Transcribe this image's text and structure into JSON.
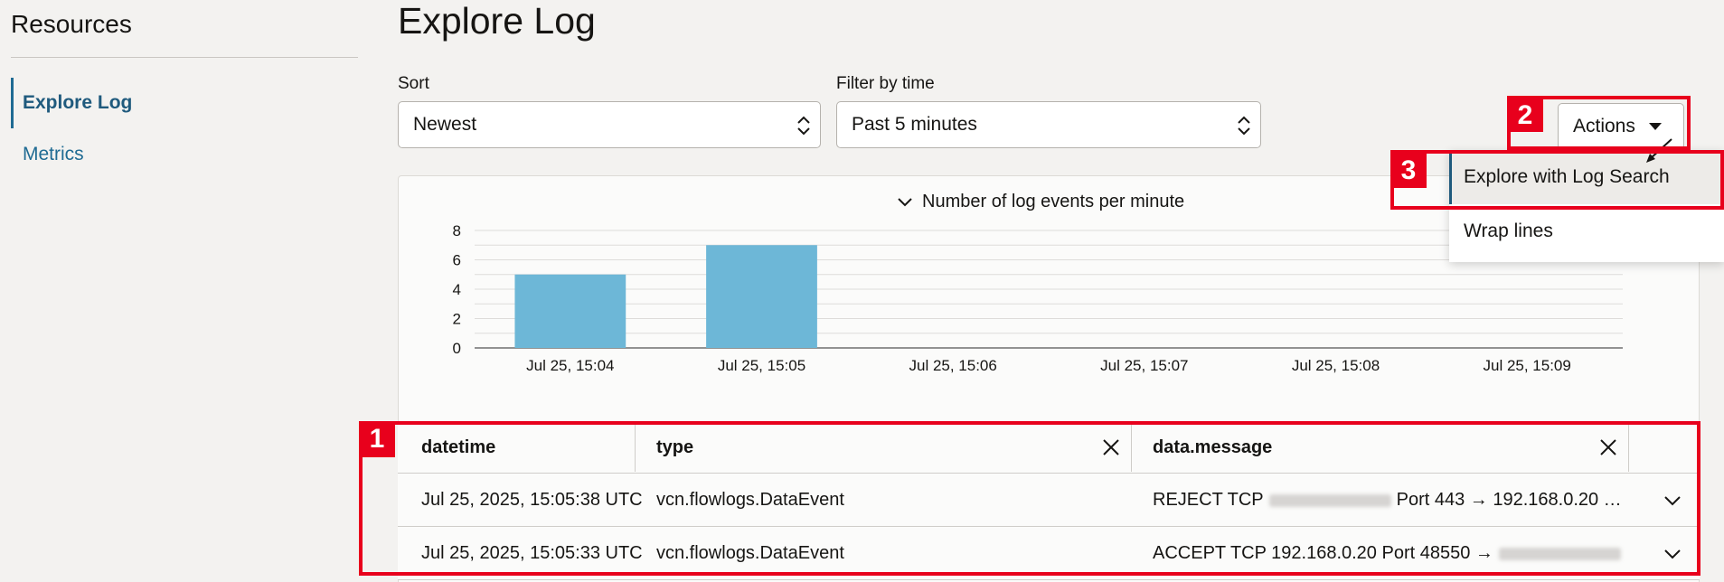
{
  "sidebar": {
    "title": "Resources",
    "items": [
      {
        "label": "Explore Log",
        "active": true
      },
      {
        "label": "Metrics",
        "active": false
      }
    ]
  },
  "page": {
    "title": "Explore Log"
  },
  "sort": {
    "label": "Sort",
    "value": "Newest"
  },
  "filter": {
    "label": "Filter by time",
    "value": "Past 5 minutes"
  },
  "actions": {
    "label": "Actions",
    "menu": [
      "Explore with Log Search",
      "Wrap lines"
    ]
  },
  "chart_data": {
    "type": "bar",
    "title": "Number of log events per minute",
    "categories": [
      "Jul 25, 15:04",
      "Jul 25, 15:05",
      "Jul 25, 15:06",
      "Jul 25, 15:07",
      "Jul 25, 15:08",
      "Jul 25, 15:09"
    ],
    "values": [
      5,
      7,
      0,
      0,
      0,
      0
    ],
    "ylim": [
      0,
      8
    ],
    "yticks": [
      0,
      2,
      4,
      6,
      8
    ],
    "grid": true,
    "color": "#6db7d7"
  },
  "table": {
    "columns": [
      "datetime",
      "type",
      "data.message"
    ],
    "rows": [
      {
        "datetime": "Jul 25, 2025, 15:05:38 UTC",
        "type": "vcn.flowlogs.DataEvent",
        "msg_pre": "REJECT TCP",
        "msg_post": "Port 443 → 192.168.0.20 …"
      },
      {
        "datetime": "Jul 25, 2025, 15:05:33 UTC",
        "type": "vcn.flowlogs.DataEvent",
        "msg_pre": "ACCEPT TCP 192.168.0.20 Port 48550 →",
        "msg_post": ""
      }
    ]
  },
  "annotations": [
    "1",
    "2",
    "3"
  ],
  "colors": {
    "accent": "#1f6b93",
    "annotation": "#e8001c",
    "bar": "#6db7d7"
  }
}
